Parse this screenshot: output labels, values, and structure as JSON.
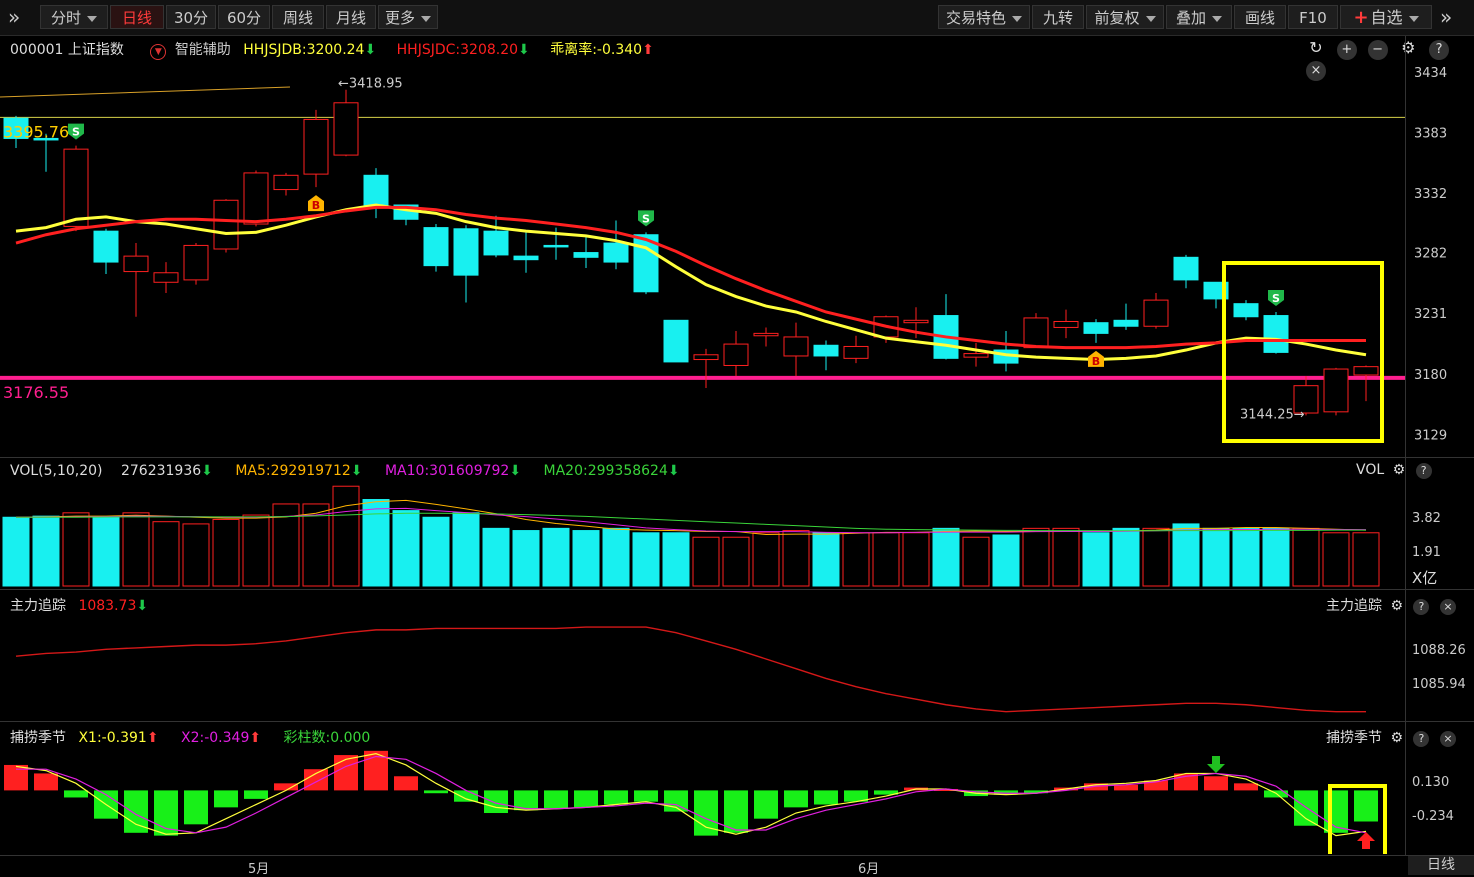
{
  "toolbar": {
    "left": [
      {
        "label": "分时",
        "caret": true
      },
      {
        "label": "日线",
        "active": true
      },
      {
        "label": "30分"
      },
      {
        "label": "60分"
      },
      {
        "label": "周线"
      },
      {
        "label": "月线"
      },
      {
        "label": "更多",
        "caret": true
      }
    ],
    "right": [
      {
        "label": "交易特色",
        "caret": true
      },
      {
        "label": "九转"
      },
      {
        "label": "前复权",
        "caret": true
      },
      {
        "label": "叠加",
        "caret": true
      },
      {
        "label": "画线"
      },
      {
        "label": "F10"
      },
      {
        "label": "自选",
        "caret": true
      }
    ]
  },
  "main": {
    "code": "000001 上证指数",
    "assist": "智能辅助",
    "hhjsjdb": "HHJSJDB:3200.24",
    "hhjsjdc": "HHJSJDC:3208.20",
    "deviation": "乖离率:-0.340",
    "yticks": [
      "3434",
      "3383",
      "3332",
      "3282",
      "3231",
      "3180",
      "3129"
    ],
    "hline_yellow_label": "3395.76",
    "hline_pink_label": "3176.55",
    "high_label": "3418.95",
    "low_label": "3144.25"
  },
  "vol": {
    "title": "VOL(5,10,20)",
    "value": "276231936",
    "ma5": "MA5:292919712",
    "ma10": "MA10:301609792",
    "ma20": "MA20:299358624",
    "right_label": "VOL",
    "yticks": [
      "3.82",
      "1.91"
    ],
    "unit": "X亿"
  },
  "zhuli": {
    "title": "主力追踪",
    "value": "1083.73",
    "right_label": "主力追踪",
    "yticks": [
      "1088.26",
      "1085.94"
    ]
  },
  "bulao": {
    "title": "捕捞季节",
    "x1": "X1:-0.391",
    "x2": "X2:-0.349",
    "bars": "彩柱数:0.000",
    "right_label": "捕捞季节",
    "yticks": [
      "0.130",
      "-0.234"
    ]
  },
  "xaxis": {
    "labels": [
      "5月",
      "6月"
    ],
    "period": "日线"
  },
  "chart_data": [
    {
      "type": "candlestick",
      "title": "000001 上证指数",
      "ylim": [
        3110,
        3450
      ],
      "yticks": [
        3434,
        3383,
        3332,
        3282,
        3231,
        3180,
        3129
      ],
      "candles": [
        [
          3395,
          3378,
          3397,
          3370
        ],
        [
          3378,
          3377,
          3382,
          3350
        ],
        [
          3304,
          3369,
          3372,
          3300
        ],
        [
          3300,
          3274,
          3302,
          3264
        ],
        [
          3266,
          3279,
          3290,
          3228
        ],
        [
          3257,
          3265,
          3274,
          3248
        ],
        [
          3259,
          3288,
          3290,
          3255
        ],
        [
          3285,
          3326,
          3327,
          3282
        ],
        [
          3306,
          3349,
          3351,
          3304
        ],
        [
          3335,
          3347,
          3349,
          3330
        ],
        [
          3348,
          3394,
          3402,
          3337
        ],
        [
          3364,
          3408,
          3419,
          3363
        ],
        [
          3347,
          3321,
          3353,
          3311
        ],
        [
          3322,
          3310,
          3322,
          3305
        ],
        [
          3303,
          3271,
          3306,
          3266
        ],
        [
          3302,
          3263,
          3305,
          3240
        ],
        [
          3300,
          3280,
          3313,
          3278
        ],
        [
          3279,
          3276,
          3300,
          3265
        ],
        [
          3288,
          3287,
          3303,
          3276
        ],
        [
          3282,
          3278,
          3297,
          3269
        ],
        [
          3290,
          3274,
          3309,
          3268
        ],
        [
          3297,
          3249,
          3299,
          3247
        ],
        [
          3225,
          3190,
          3225,
          3190
        ],
        [
          3192,
          3196,
          3201,
          3168
        ],
        [
          3187,
          3205,
          3216,
          3178
        ],
        [
          3212,
          3214,
          3219,
          3203
        ],
        [
          3195,
          3211,
          3223,
          3178
        ],
        [
          3204,
          3195,
          3208,
          3183
        ],
        [
          3193,
          3203,
          3212,
          3189
        ],
        [
          3211,
          3228,
          3229,
          3206
        ],
        [
          3223,
          3225,
          3236,
          3210
        ],
        [
          3229,
          3193,
          3247,
          3192
        ],
        [
          3194,
          3197,
          3206,
          3186
        ],
        [
          3200,
          3189,
          3216,
          3182
        ],
        [
          3202,
          3227,
          3231,
          3202
        ],
        [
          3219,
          3224,
          3234,
          3210
        ],
        [
          3223,
          3214,
          3226,
          3206
        ],
        [
          3225,
          3220,
          3239,
          3217
        ],
        [
          3220,
          3242,
          3248,
          3218
        ],
        [
          3278,
          3259,
          3280,
          3252
        ],
        [
          3257,
          3243,
          3257,
          3235
        ],
        [
          3239,
          3228,
          3242,
          3225
        ],
        [
          3229,
          3198,
          3232,
          3197
        ],
        [
          3147,
          3170,
          3178,
          3145
        ],
        [
          3148,
          3184,
          3185,
          3145
        ],
        [
          3179,
          3186,
          3187,
          3157
        ]
      ],
      "hlines": [
        {
          "value": 3395.76,
          "color": "#d8d24a"
        },
        {
          "value": 3176.55,
          "color": "#ff1f8f"
        }
      ],
      "series": [
        {
          "color": "#ffff3c",
          "values": [
            3300,
            3303,
            3310,
            3312,
            3308,
            3306,
            3302,
            3298,
            3299,
            3305,
            3312,
            3318,
            3322,
            3318,
            3315,
            3308,
            3303,
            3300,
            3298,
            3296,
            3292,
            3286,
            3270,
            3255,
            3245,
            3237,
            3232,
            3224,
            3217,
            3210,
            3207,
            3204,
            3200,
            3196,
            3194,
            3193,
            3192,
            3193,
            3195,
            3200,
            3206,
            3210,
            3209,
            3205,
            3200,
            3196
          ]
        },
        {
          "color": "#ff2020",
          "values": [
            3290,
            3297,
            3302,
            3305,
            3308,
            3310,
            3310,
            3309,
            3308,
            3310,
            3313,
            3317,
            3320,
            3320,
            3318,
            3314,
            3311,
            3309,
            3306,
            3303,
            3299,
            3293,
            3283,
            3271,
            3260,
            3250,
            3241,
            3232,
            3226,
            3220,
            3215,
            3211,
            3208,
            3205,
            3203,
            3202,
            3202,
            3202,
            3203,
            3205,
            3206,
            3208,
            3208,
            3208,
            3208,
            3208
          ]
        }
      ],
      "markers": [
        {
          "index": 2,
          "label": "S"
        },
        {
          "index": 10,
          "label": "B"
        },
        {
          "index": 21,
          "label": "S"
        },
        {
          "index": 36,
          "label": "B"
        },
        {
          "index": 42,
          "label": "S"
        }
      ]
    },
    {
      "type": "bar",
      "title": "VOL(5,10,20)",
      "ylim": [
        0,
        4.6
      ],
      "values": [
        3.1,
        3.15,
        3.3,
        3.1,
        3.3,
        2.9,
        2.8,
        3.0,
        3.2,
        3.7,
        3.7,
        4.5,
        3.9,
        3.4,
        3.1,
        3.3,
        2.6,
        2.5,
        2.6,
        2.5,
        2.6,
        2.4,
        2.4,
        2.2,
        2.2,
        2.4,
        2.5,
        2.4,
        2.4,
        2.4,
        2.4,
        2.6,
        2.2,
        2.3,
        2.6,
        2.6,
        2.4,
        2.6,
        2.6,
        2.8,
        2.6,
        2.6,
        2.6,
        2.6,
        2.4,
        2.4
      ],
      "series": [
        {
          "name": "MA5",
          "color": "#ffb400",
          "values": [
            3.1,
            3.12,
            3.15,
            3.15,
            3.19,
            3.15,
            3.1,
            3.06,
            3.06,
            3.12,
            3.28,
            3.62,
            3.8,
            3.86,
            3.68,
            3.48,
            3.26,
            3.0,
            2.82,
            2.7,
            2.56,
            2.52,
            2.5,
            2.46,
            2.46,
            2.32,
            2.34,
            2.34,
            2.38,
            2.42,
            2.42,
            2.46,
            2.48,
            2.46,
            2.46,
            2.48,
            2.46,
            2.48,
            2.52,
            2.6,
            2.6,
            2.64,
            2.64,
            2.6,
            2.56,
            2.52
          ]
        },
        {
          "name": "MA10",
          "color": "#e020e0",
          "values": [
            3.1,
            3.1,
            3.12,
            3.13,
            3.15,
            3.14,
            3.13,
            3.1,
            3.1,
            3.14,
            3.2,
            3.36,
            3.48,
            3.5,
            3.4,
            3.31,
            3.21,
            3.13,
            3.02,
            2.9,
            2.76,
            2.62,
            2.54,
            2.48,
            2.45,
            2.45,
            2.45,
            2.42,
            2.4,
            2.4,
            2.42,
            2.43,
            2.43,
            2.43,
            2.45,
            2.46,
            2.46,
            2.47,
            2.49,
            2.52,
            2.54,
            2.55,
            2.56,
            2.56,
            2.55,
            2.54
          ]
        },
        {
          "name": "MA20",
          "color": "#3ad43a",
          "values": [
            3.1,
            3.1,
            3.1,
            3.11,
            3.12,
            3.12,
            3.12,
            3.12,
            3.12,
            3.13,
            3.16,
            3.2,
            3.25,
            3.28,
            3.28,
            3.27,
            3.25,
            3.22,
            3.18,
            3.14,
            3.08,
            3.02,
            2.96,
            2.9,
            2.84,
            2.78,
            2.72,
            2.66,
            2.6,
            2.56,
            2.54,
            2.53,
            2.52,
            2.51,
            2.5,
            2.5,
            2.5,
            2.49,
            2.49,
            2.5,
            2.5,
            2.5,
            2.51,
            2.51,
            2.52,
            2.52
          ]
        }
      ]
    },
    {
      "type": "line",
      "title": "主力追踪",
      "ylim": [
        1083.4,
        1090.9
      ],
      "series": [
        {
          "name": "主力追踪",
          "color": "#d41818",
          "values": [
            1088.0,
            1088.2,
            1088.3,
            1088.5,
            1088.6,
            1088.7,
            1088.8,
            1088.8,
            1088.9,
            1089.1,
            1089.4,
            1089.7,
            1089.9,
            1089.9,
            1090.0,
            1090.0,
            1090.0,
            1090.0,
            1090.0,
            1090.1,
            1090.1,
            1090.1,
            1089.7,
            1089.1,
            1088.5,
            1087.8,
            1087.1,
            1086.4,
            1085.8,
            1085.3,
            1084.9,
            1084.5,
            1084.2,
            1084.0,
            1084.1,
            1084.2,
            1084.3,
            1084.4,
            1084.5,
            1084.6,
            1084.6,
            1084.5,
            1084.3,
            1084.1,
            1084.0,
            1084.0
          ]
        }
      ]
    },
    {
      "type": "bar",
      "title": "捕捞季节",
      "ylim": [
        -0.45,
        0.3
      ],
      "values": [
        0.18,
        0.12,
        -0.05,
        -0.2,
        -0.3,
        -0.32,
        -0.24,
        -0.12,
        -0.06,
        0.05,
        0.15,
        0.25,
        0.28,
        0.1,
        -0.02,
        -0.08,
        -0.16,
        -0.14,
        -0.13,
        -0.12,
        -0.1,
        -0.08,
        -0.15,
        -0.32,
        -0.3,
        -0.2,
        -0.12,
        -0.1,
        -0.08,
        -0.03,
        0.02,
        0.01,
        -0.04,
        -0.03,
        -0.02,
        0.02,
        0.05,
        0.04,
        0.07,
        0.12,
        0.1,
        0.05,
        -0.05,
        -0.25,
        -0.3,
        -0.22
      ],
      "series": [
        {
          "name": "X1",
          "color": "#ffff3c",
          "values": [
            0.17,
            0.14,
            0.05,
            -0.1,
            -0.24,
            -0.31,
            -0.3,
            -0.2,
            -0.1,
            0.0,
            0.12,
            0.22,
            0.26,
            0.18,
            0.05,
            -0.06,
            -0.12,
            -0.14,
            -0.13,
            -0.12,
            -0.1,
            -0.08,
            -0.12,
            -0.26,
            -0.31,
            -0.26,
            -0.16,
            -0.11,
            -0.08,
            -0.04,
            0.01,
            0.01,
            -0.02,
            -0.03,
            -0.02,
            0.01,
            0.04,
            0.05,
            0.07,
            0.12,
            0.12,
            0.08,
            -0.02,
            -0.2,
            -0.32,
            -0.29
          ]
        },
        {
          "name": "X2",
          "color": "#e020e0",
          "values": [
            0.15,
            0.15,
            0.08,
            -0.03,
            -0.17,
            -0.27,
            -0.3,
            -0.26,
            -0.16,
            -0.05,
            0.06,
            0.17,
            0.24,
            0.22,
            0.12,
            0.0,
            -0.09,
            -0.13,
            -0.13,
            -0.12,
            -0.11,
            -0.09,
            -0.1,
            -0.2,
            -0.28,
            -0.28,
            -0.2,
            -0.14,
            -0.1,
            -0.06,
            -0.01,
            0.01,
            -0.01,
            -0.02,
            -0.02,
            0.0,
            0.03,
            0.04,
            0.06,
            0.1,
            0.12,
            0.1,
            0.03,
            -0.12,
            -0.26,
            -0.3
          ]
        }
      ],
      "markers": [
        {
          "index": 40,
          "label": "down-arrow"
        },
        {
          "index": 45,
          "label": "up-arrow"
        }
      ]
    }
  ]
}
